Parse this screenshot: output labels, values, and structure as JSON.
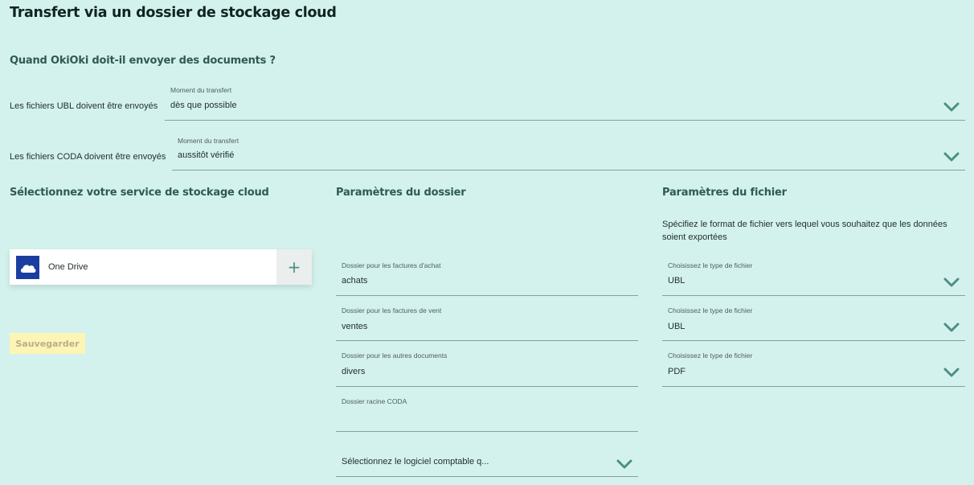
{
  "page": {
    "title": "Transfert via un dossier de stockage cloud"
  },
  "when": {
    "title": "Quand OkiOki doit-il envoyer des documents ?",
    "ubl": {
      "label": "Les fichiers UBL doivent être envoyés",
      "field_label": "Moment du transfert",
      "value": "dès que possible"
    },
    "coda": {
      "label": "Les fichiers CODA doivent être envoyés",
      "field_label": "Moment du transfert",
      "value": "aussitôt vérifié"
    }
  },
  "cloud": {
    "title": "Sélectionnez votre service de stockage cloud",
    "service_name": "One Drive",
    "add_symbol": "+",
    "save_label": "Sauvegarder"
  },
  "folder": {
    "title": "Paramètres du dossier",
    "purchase": {
      "label": "Dossier pour les factures d'achat",
      "value": "achats"
    },
    "sales": {
      "label": "Dossier pour les factures de vent",
      "value": "ventes"
    },
    "other": {
      "label": "Dossier pour les autres documents",
      "value": "divers"
    },
    "coda_root": {
      "label": "Dossier racine CODA",
      "value": ""
    },
    "software_select": {
      "placeholder": "Sélectionnez le logiciel comptable q..."
    }
  },
  "file": {
    "title": "Paramètres du fichier",
    "description": "Spécifiez le format de fichier vers lequel vous souhaitez que les données soient exportées",
    "type1": {
      "label": "Choisissez le type de fichier",
      "value": "UBL"
    },
    "type2": {
      "label": "Choisissez le type de fichier",
      "value": "UBL"
    },
    "type3": {
      "label": "Choisissez le type de fichier",
      "value": "PDF"
    }
  },
  "colors": {
    "background": "#d4f2ed",
    "accent": "#4c8f85",
    "save_button": "#fdf5b5",
    "onedrive": "#1a3ea0"
  },
  "icons": {
    "chevron": "chevron-down-icon",
    "cloud": "onedrive-cloud-icon",
    "add": "plus-icon"
  }
}
